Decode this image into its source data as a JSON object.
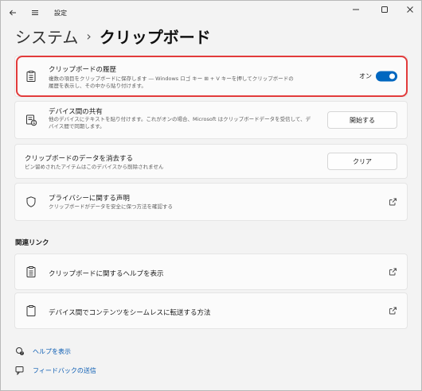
{
  "window": {
    "title": "設定",
    "controls": [
      "minimize",
      "maximize",
      "close"
    ]
  },
  "breadcrumb": {
    "parent": "システム",
    "separator": "›",
    "current": "クリップボード"
  },
  "clipboard_history": {
    "title": "クリップボードの履歴",
    "desc_line1": "複数の項目をクリップボードに保存します ― Windows ロゴ キー ⊞ + V キーを押してクリップボードの",
    "desc_line2": "履歴を表示し、その中から貼り付けます。",
    "toggle_label": "オン",
    "toggle_on": true,
    "icon": "clipboard-list-icon"
  },
  "sync_devices": {
    "title": "デバイス間の共有",
    "desc_line1": "他のデバイスにテキストを貼り付けます。これがオンの場合、Microsoft はクリップボードデータを受信して、デ",
    "desc_line2": "バイス間で同期します。",
    "button_label": "開始する",
    "icon": "devices-sync-icon"
  },
  "clear_data": {
    "title": "クリップボードのデータを消去する",
    "desc": "ピン留めされたアイテムはこのデバイスから削除されません",
    "button_label": "クリア"
  },
  "privacy": {
    "title": "プライバシーに関する声明",
    "desc": "クリップボードがデータを安全に保つ方法を確認する",
    "icon": "shield-icon"
  },
  "related_links": {
    "heading": "関連リンク",
    "items": [
      {
        "label": "クリップボードに関するヘルプを表示",
        "icon": "clipboard-list-icon"
      },
      {
        "label": "デバイス間でコンテンツをシームレスに転送する方法",
        "icon": "clipboard-icon"
      }
    ]
  },
  "footer": {
    "help": "ヘルプを表示",
    "feedback": "フィードバックの送信"
  },
  "colors": {
    "accent": "#0067c0",
    "highlight": "#e23b3b",
    "link": "#0a5cb3"
  }
}
